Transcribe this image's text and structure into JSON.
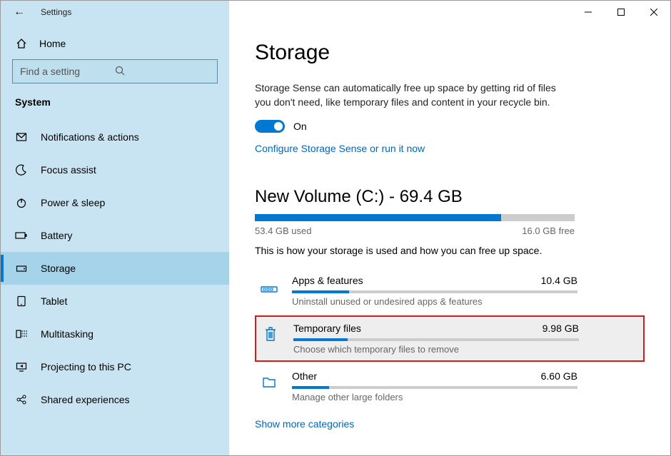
{
  "titlebar": {
    "app_name": "Settings"
  },
  "sidebar": {
    "home_label": "Home",
    "search_placeholder": "Find a setting",
    "section_label": "System",
    "items": [
      {
        "label": "Notifications & actions"
      },
      {
        "label": "Focus assist"
      },
      {
        "label": "Power & sleep"
      },
      {
        "label": "Battery"
      },
      {
        "label": "Storage"
      },
      {
        "label": "Tablet"
      },
      {
        "label": "Multitasking"
      },
      {
        "label": "Projecting to this PC"
      },
      {
        "label": "Shared experiences"
      }
    ]
  },
  "content": {
    "heading": "Storage",
    "sense_desc": "Storage Sense can automatically free up space by getting rid of files you don't need, like temporary files and content in your recycle bin.",
    "toggle_state": "On",
    "configure_link": "Configure Storage Sense or run it now",
    "volume_heading": "New Volume (C:) - 69.4 GB",
    "volume_used_label": "53.4 GB used",
    "volume_free_label": "16.0 GB free",
    "volume_fill_pct": 77,
    "usage_desc": "This is how your storage is used and how you can free up space.",
    "categories": [
      {
        "name": "Apps & features",
        "size": "10.4 GB",
        "hint": "Uninstall unused or undesired apps & features",
        "fill_pct": 20
      },
      {
        "name": "Temporary files",
        "size": "9.98 GB",
        "hint": "Choose which temporary files to remove",
        "fill_pct": 19
      },
      {
        "name": "Other",
        "size": "6.60 GB",
        "hint": "Manage other large folders",
        "fill_pct": 13
      }
    ],
    "show_more": "Show more categories"
  }
}
